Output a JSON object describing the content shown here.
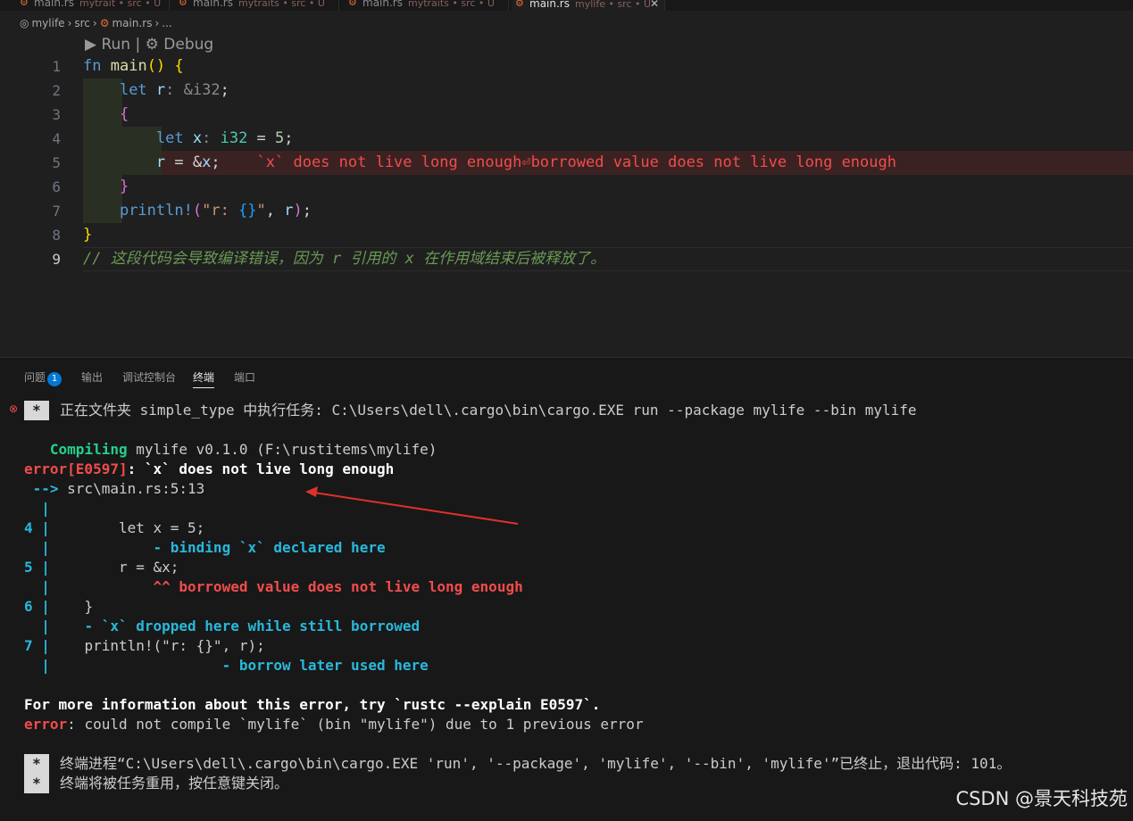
{
  "tabs": [
    {
      "name": "main.rs",
      "path": "mytrait • src • U"
    },
    {
      "name": "main.rs",
      "path": "mytraits • src • U"
    },
    {
      "name": "main.rs",
      "path": "mytraits • src • U"
    },
    {
      "name": "main.rs",
      "path": "mylife • src • U"
    }
  ],
  "breadcrumb": [
    "mylife",
    "src",
    "main.rs",
    "..."
  ],
  "codelens": {
    "run": "Run",
    "debug": "Debug"
  },
  "line_numbers": [
    "1",
    "2",
    "3",
    "4",
    "5",
    "6",
    "7",
    "8",
    "9"
  ],
  "inline_error": "`x` does not live long enough⏎borrowed value does not live long enough",
  "comment": "// 这段代码会导致编译错误，因为 r 引用的 x 在作用域结束后被释放了。",
  "panel_tabs": {
    "problems": "问题",
    "problems_count": "1",
    "output": "输出",
    "debug_console": "调试控制台",
    "terminal": "终端",
    "ports": "端口"
  },
  "terminal": {
    "task_line": "正在文件夹 simple_type 中执行任务: C:\\Users\\dell\\.cargo\\bin\\cargo.EXE run --package mylife --bin mylife",
    "compiling_word": "Compiling",
    "compiling_rest": " mylife v0.1.0 (F:\\rustitems\\mylife)",
    "error_code": "error[E0597]",
    "error_msg": ": `x` does not live long enough",
    "arrow": " -->",
    "location": " src\\main.rs:5:13",
    "src4": "        let x = 5;",
    "note4": "            - binding `x` declared here",
    "src5": "        r = &x;",
    "note5": "            ^^ borrowed value does not live long enough",
    "src6": "    }",
    "note6": "    - `x` dropped here while still borrowed",
    "src7": "    println!(\"r: {}\", r);",
    "note7": "                    - borrow later used here",
    "more_info": "For more information about this error, try `rustc --explain E0597`.",
    "final_err_word": "error",
    "final_err_rest": ": could not compile `mylife` (bin \"mylife\") due to 1 previous error",
    "exit_line": "终端进程“C:\\Users\\dell\\.cargo\\bin\\cargo.EXE 'run', '--package', 'mylife', '--bin', 'mylife'”已终止，退出代码: 101。",
    "reuse_line": "终端将被任务重用，按任意键关闭。",
    "star": "*"
  },
  "watermark": "CSDN @景天科技苑",
  "colors": {
    "accent": "#0078d4",
    "error": "#f14c4c",
    "success": "#23d18b",
    "info": "#29b8db"
  }
}
